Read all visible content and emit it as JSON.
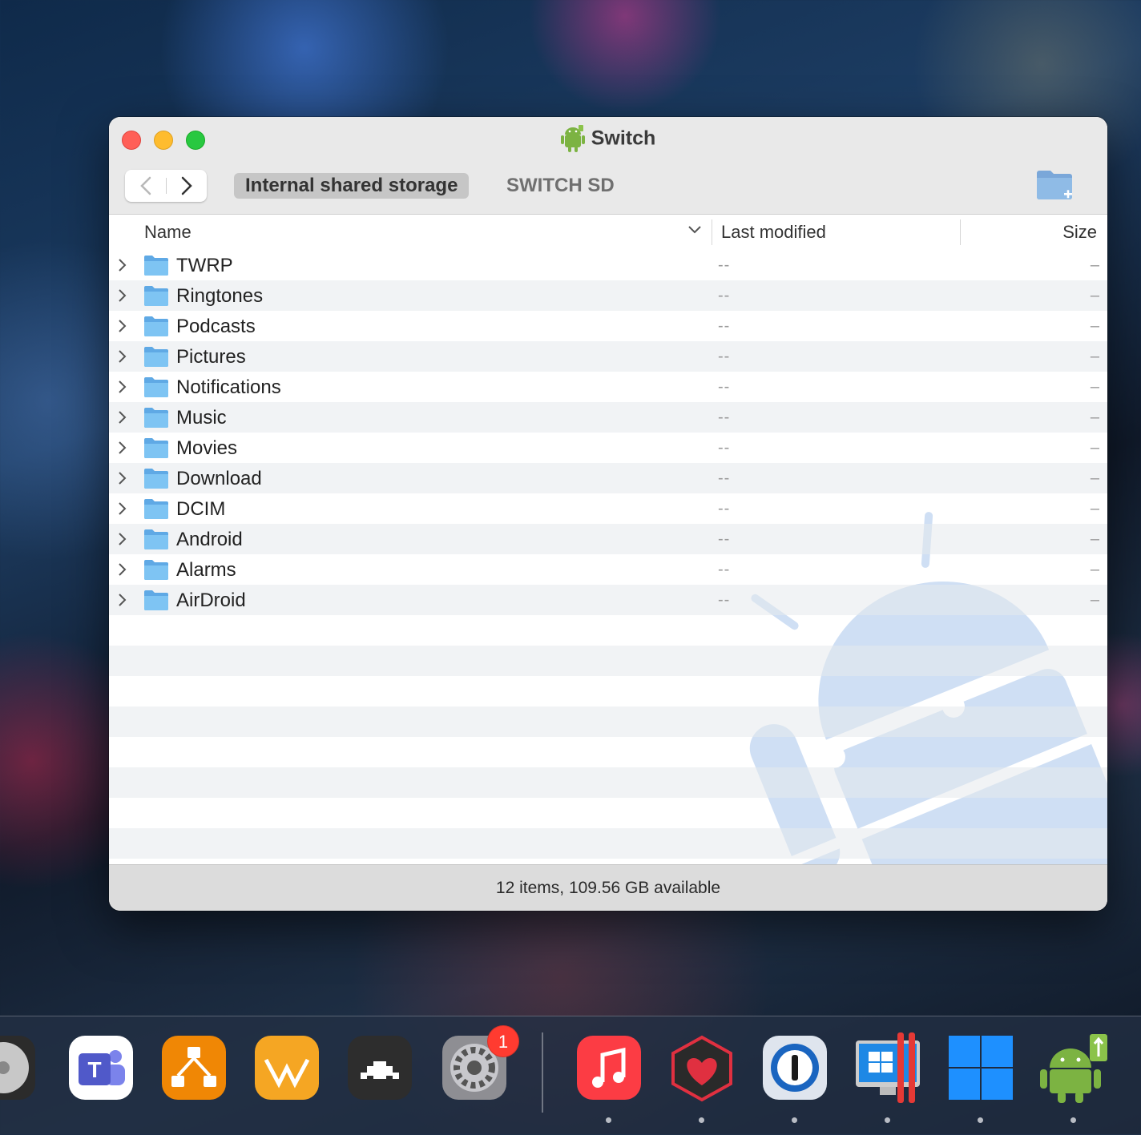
{
  "window": {
    "title": "Switch"
  },
  "toolbar": {
    "tabs": [
      {
        "label": "Internal shared storage",
        "active": true
      },
      {
        "label": "SWITCH SD",
        "active": false
      }
    ]
  },
  "table": {
    "columns": {
      "name": "Name",
      "last_modified": "Last modified",
      "size": "Size"
    },
    "rows": [
      {
        "name": "TWRP",
        "modified": "--",
        "size": "–"
      },
      {
        "name": "Ringtones",
        "modified": "--",
        "size": "–"
      },
      {
        "name": "Podcasts",
        "modified": "--",
        "size": "–"
      },
      {
        "name": "Pictures",
        "modified": "--",
        "size": "–"
      },
      {
        "name": "Notifications",
        "modified": "--",
        "size": "–"
      },
      {
        "name": "Music",
        "modified": "--",
        "size": "–"
      },
      {
        "name": "Movies",
        "modified": "--",
        "size": "–"
      },
      {
        "name": "Download",
        "modified": "--",
        "size": "–"
      },
      {
        "name": "DCIM",
        "modified": "--",
        "size": "–"
      },
      {
        "name": "Android",
        "modified": "--",
        "size": "–"
      },
      {
        "name": "Alarms",
        "modified": "--",
        "size": "–"
      },
      {
        "name": "AirDroid",
        "modified": "--",
        "size": "–"
      }
    ]
  },
  "status": {
    "text": "12 items, 109.56 GB available"
  },
  "dock": {
    "badge_count": "1",
    "icons": [
      "disk-utility-icon",
      "teams-icon",
      "drawio-icon",
      "infuse-icon",
      "retroarch-icon",
      "system-preferences-icon",
      "music-icon",
      "health-icon",
      "onepassword-icon",
      "parallels-windows-icon",
      "windows-icon",
      "android-file-transfer-icon"
    ]
  },
  "colors": {
    "close": "#ff5f57",
    "minimize": "#febc2e",
    "maximize": "#28c840",
    "folder_blue": "#5fb8ef",
    "android_green": "#7cb342",
    "watermark": "#cfdff4"
  }
}
